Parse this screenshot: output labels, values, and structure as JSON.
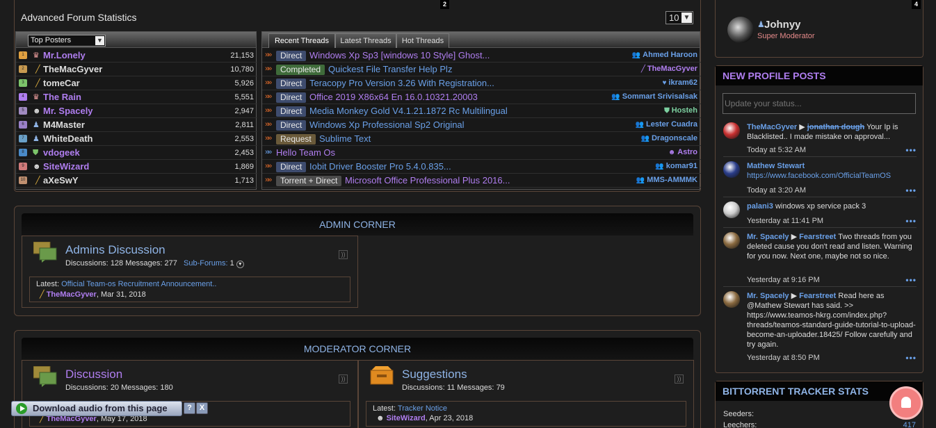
{
  "stats": {
    "title": "Advanced Forum Statistics",
    "badge": "2",
    "limit": "10",
    "posters_select": "Top Posters",
    "tabs": [
      "Recent Threads",
      "Latest Threads",
      "Hot Threads"
    ],
    "posters": [
      {
        "rank": "1",
        "name": "Mr.Lonely",
        "count": "21,153",
        "color": "#b07ef0",
        "icon": "♛",
        "icon_color": "#f0a0a0"
      },
      {
        "rank": "2",
        "name": "TheMacGyver",
        "count": "10,780",
        "color": "#dddddd",
        "icon": "╱",
        "icon_color": "#e0b040"
      },
      {
        "rank": "3",
        "name": "tomeCar",
        "count": "5,926",
        "color": "#dddddd",
        "icon": "╱",
        "icon_color": "#e0b040"
      },
      {
        "rank": "4",
        "name": "The Rain",
        "count": "5,551",
        "color": "#b07ef0",
        "icon": "♛",
        "icon_color": "#f0a0a0"
      },
      {
        "rank": "5",
        "name": "Mr. Spacely",
        "count": "2,947",
        "color": "#b07ef0",
        "icon": "☻",
        "icon_color": "#dddddd"
      },
      {
        "rank": "6",
        "name": "M4Master",
        "count": "2,811",
        "color": "#dddddd",
        "icon": "♟",
        "icon_color": "#8fb4e6"
      },
      {
        "rank": "7",
        "name": "WhiteDeath",
        "count": "2,553",
        "color": "#dddddd",
        "icon": "♟",
        "icon_color": "#8fb4e6"
      },
      {
        "rank": "8",
        "name": "vdogeek",
        "count": "2,453",
        "color": "#b07ef0",
        "icon": "⛊",
        "icon_color": "#7cc46a"
      },
      {
        "rank": "9",
        "name": "SiteWizard",
        "count": "1,869",
        "color": "#b07ef0",
        "icon": "☻",
        "icon_color": "#dddddd"
      },
      {
        "rank": "10",
        "name": "aXeSwY",
        "count": "1,713",
        "color": "#dddddd",
        "icon": "╱",
        "icon_color": "#e0b040"
      }
    ],
    "threads": [
      {
        "prefix": "Direct",
        "prefix_type": "direct",
        "title": "Windows Xp Sp3 [windows 10 Style] Ghost...",
        "title_color": "#b07ef0",
        "user": "Ahmed Haroon",
        "user_color": "#6aa0e8",
        "user_icon": "👥"
      },
      {
        "prefix": "Completed",
        "prefix_type": "completed",
        "title": "Quickest File Transfer Help Plz",
        "title_color": "#6aa0e8",
        "user": "TheMacGyver",
        "user_color": "#b07ef0",
        "user_icon": "╱"
      },
      {
        "prefix": "Direct",
        "prefix_type": "direct",
        "title": "Teracopy Pro Version 3.26 With Registration...",
        "title_color": "#6aa0e8",
        "user": "ikram62",
        "user_color": "#6aa0e8",
        "user_icon": "♥"
      },
      {
        "prefix": "Direct",
        "prefix_type": "direct",
        "title": "Office 2019 X86x64 En 16.0.10321.20003",
        "title_color": "#b07ef0",
        "user": "Sommart Srivisalsak",
        "user_color": "#6aa0e8",
        "user_icon": "👥"
      },
      {
        "prefix": "Direct",
        "prefix_type": "direct",
        "title": "Media Monkey Gold V4.1.21.1872 Rc Multilingual",
        "title_color": "#6aa0e8",
        "user": "Hosteh",
        "user_color": "#7cd0a0",
        "user_icon": "⛊"
      },
      {
        "prefix": "Direct",
        "prefix_type": "direct",
        "title": "Windows Xp Professional Sp2 Original",
        "title_color": "#6aa0e8",
        "user": "Lester Cuadra",
        "user_color": "#6aa0e8",
        "user_icon": "👥"
      },
      {
        "prefix": "Request",
        "prefix_type": "request",
        "title": "Sublime Text",
        "title_color": "#6aa0e8",
        "user": "Dragonscale",
        "user_color": "#6aa0e8",
        "user_icon": "👥"
      },
      {
        "prefix": "",
        "prefix_type": "none",
        "title": "Hello Team Os",
        "title_color": "#b07ef0",
        "user": "Astro",
        "user_color": "#b07ef0",
        "user_icon": "☻"
      },
      {
        "prefix": "Direct",
        "prefix_type": "direct",
        "title": "Iobit Driver Booster Pro 5.4.0.835...",
        "title_color": "#6aa0e8",
        "user": "komar91",
        "user_color": "#6aa0e8",
        "user_icon": "👥"
      },
      {
        "prefix": "Torrent + Direct",
        "prefix_type": "torrent",
        "title": "Microsoft Office Professional Plus 2016...",
        "title_color": "#b07ef0",
        "user": "MMS-AMMMK",
        "user_color": "#6aa0e8",
        "user_icon": "👥"
      }
    ]
  },
  "admin_corner": {
    "title": "ADMIN CORNER",
    "forum": {
      "title": "Admins Discussion",
      "discussions_label": "Discussions:",
      "discussions": "128",
      "messages_label": "Messages:",
      "messages": "277",
      "subforums_label": "Sub-Forums:",
      "subforums": "1",
      "latest_label": "Latest:",
      "latest_title": "Official Team-os Recruitment Announcement..",
      "latest_user": "TheMacGyver",
      "latest_date": ", Mar 31, 2018"
    }
  },
  "moderator_corner": {
    "title": "MODERATOR CORNER",
    "forums": [
      {
        "title": "Discussion",
        "discussions_label": "Discussions:",
        "discussions": "20",
        "messages_label": "Messages:",
        "messages": "180",
        "latest_user": "TheMacGyver",
        "latest_date": ", May 17, 2018"
      },
      {
        "title": "Suggestions",
        "discussions_label": "Discussions:",
        "discussions": "11",
        "messages_label": "Messages:",
        "messages": "79",
        "latest_label": "Latest:",
        "latest_title": "Tracker Notice",
        "latest_user": "SiteWizard",
        "latest_date": ", Apr 23, 2018"
      }
    ]
  },
  "user": {
    "badge": "4",
    "name": "Johnyy",
    "role": "Super Moderator"
  },
  "profile_posts": {
    "title": "NEW PROFILE POSTS",
    "status_placeholder": "Update your status...",
    "more": "•••",
    "posts": [
      {
        "author": "TheMacGyver",
        "arrow": "▶",
        "target": "jonathan dough",
        "text": "Your Ip is Blacklisted.. I made mistake on approval...",
        "time": "Today at 5:32 AM",
        "avatar_color": "#c83030"
      },
      {
        "author": "Mathew Stewart",
        "text": "https://www.facebook.com/OfficialTeamOS",
        "time": "Today at 3:20 AM",
        "avatar_color": "#2a3d8a"
      },
      {
        "author": "palani3",
        "text": "windows xp service pack 3",
        "time": "Yesterday at 11:41 PM",
        "avatar_color": "#cccccc"
      },
      {
        "author": "Mr. Spacely",
        "arrow": "▶",
        "target": "Fearstreet",
        "text": "Two threads from you deleted cause you don't read and listen. Warning for you now. Next one, maybe not so nice.",
        "time": "Yesterday at 9:16 PM",
        "avatar_color": "#8a6a40"
      },
      {
        "author": "Mr. Spacely",
        "arrow": "▶",
        "target": "Fearstreet",
        "text": "Read here as @Mathew Stewart has said. >> https://www.teamos-hkrg.com/index.php?threads/teamos-standard-guide-tutorial-to-upload-become-an-uploader.18425/ Follow carefully and try again.",
        "time": "Yesterday at 8:50 PM",
        "avatar_color": "#8a6a40"
      }
    ]
  },
  "tracker": {
    "title": "BITTORRENT TRACKER STATS",
    "seeders_label": "Seeders:",
    "leechers_label": "Leechers:",
    "leechers": "417"
  },
  "download_bar": {
    "label": "Download audio from this page",
    "help": "?",
    "close": "X"
  },
  "colors": {
    "accent_blue": "#6aa0e8",
    "purple": "#b07ef0",
    "border": "#5a4538",
    "notification": "#f27f7f"
  }
}
